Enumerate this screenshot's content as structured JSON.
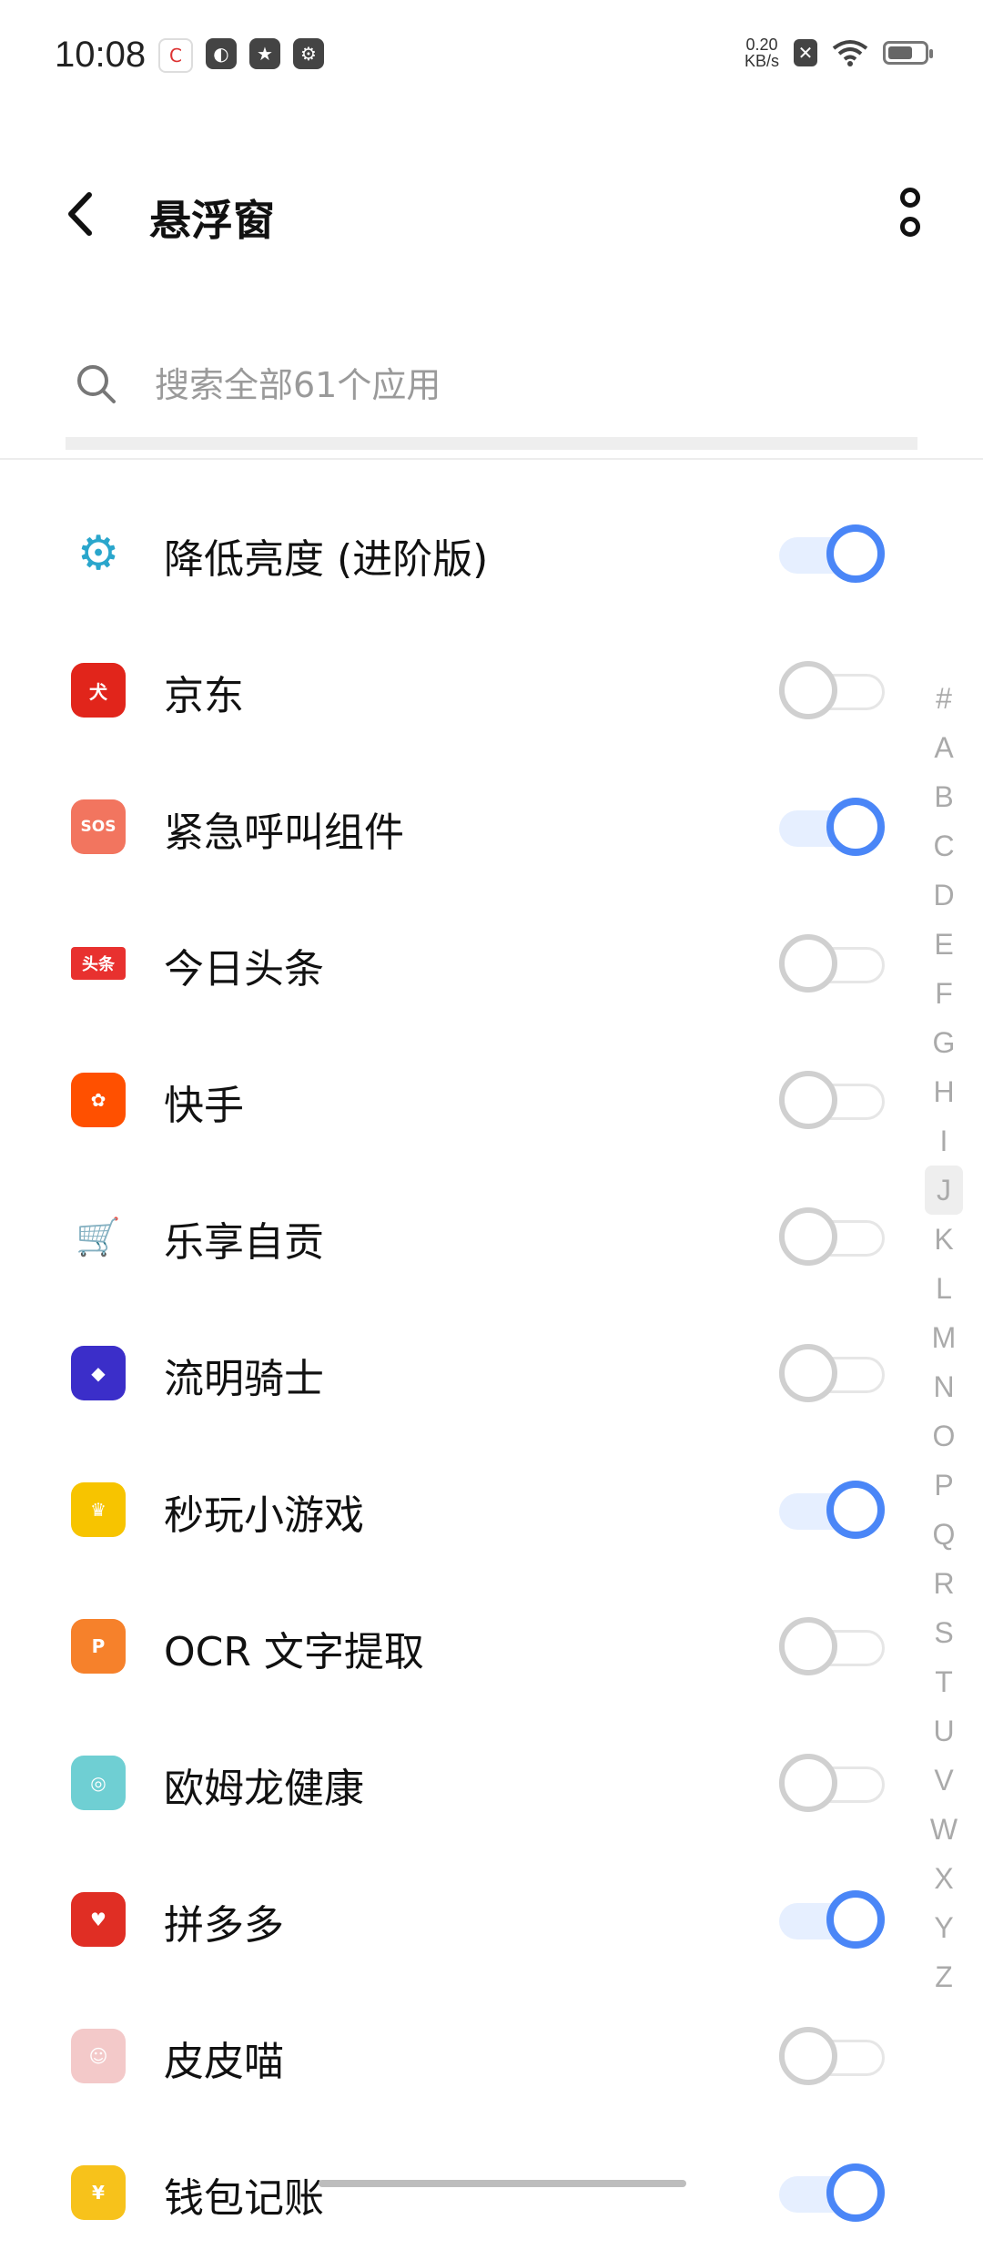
{
  "status_bar": {
    "time": "10:08",
    "speed_value": "0.20",
    "speed_unit": "KB/s"
  },
  "header": {
    "title": "悬浮窗"
  },
  "search": {
    "placeholder": "搜索全部61个应用"
  },
  "apps": [
    {
      "name": "降低亮度 (进阶版)",
      "icon": "brightness-gear-icon",
      "icon_color": "#2aa6cc",
      "enabled": true
    },
    {
      "name": "京东",
      "icon": "jd-dog-icon",
      "icon_color": "#e1251b",
      "enabled": false
    },
    {
      "name": "紧急呼叫组件",
      "icon": "sos-icon",
      "icon_color": "#f2755f",
      "enabled": true
    },
    {
      "name": "今日头条",
      "icon": "toutiao-icon",
      "icon_color": "#e8312f",
      "enabled": false
    },
    {
      "name": "快手",
      "icon": "kuaishou-icon",
      "icon_color": "#ff5000",
      "enabled": false
    },
    {
      "name": "乐享自贡",
      "icon": "cart-icon",
      "icon_color": "#2f8ad8",
      "enabled": false
    },
    {
      "name": "流明骑士",
      "icon": "game-knight-icon",
      "icon_color": "#3b2ec9",
      "enabled": false
    },
    {
      "name": "秒玩小游戏",
      "icon": "vivo-game-icon",
      "icon_color": "#f7c400",
      "enabled": true
    },
    {
      "name": "OCR 文字提取",
      "icon": "ocr-icon",
      "icon_color": "#f6812b",
      "enabled": false
    },
    {
      "name": "欧姆龙健康",
      "icon": "omron-icon",
      "icon_color": "#6fcfd3",
      "enabled": false
    },
    {
      "name": "拼多多",
      "icon": "pinduoduo-icon",
      "icon_color": "#e02e24",
      "enabled": true
    },
    {
      "name": "皮皮喵",
      "icon": "anime-girl-icon",
      "icon_color": "#f3c9c9",
      "enabled": false
    },
    {
      "name": "钱包记账",
      "icon": "wallet-icon",
      "icon_color": "#f7c21b",
      "enabled": true
    }
  ],
  "alphabet": [
    "#",
    "A",
    "B",
    "C",
    "D",
    "E",
    "F",
    "G",
    "H",
    "I",
    "J",
    "K",
    "L",
    "M",
    "N",
    "O",
    "P",
    "Q",
    "R",
    "S",
    "T",
    "U",
    "V",
    "W",
    "X",
    "Y",
    "Z"
  ],
  "alphabet_active": "J",
  "colors": {
    "accent": "#4a86f7",
    "toggle_on_track": "#e6efff"
  }
}
